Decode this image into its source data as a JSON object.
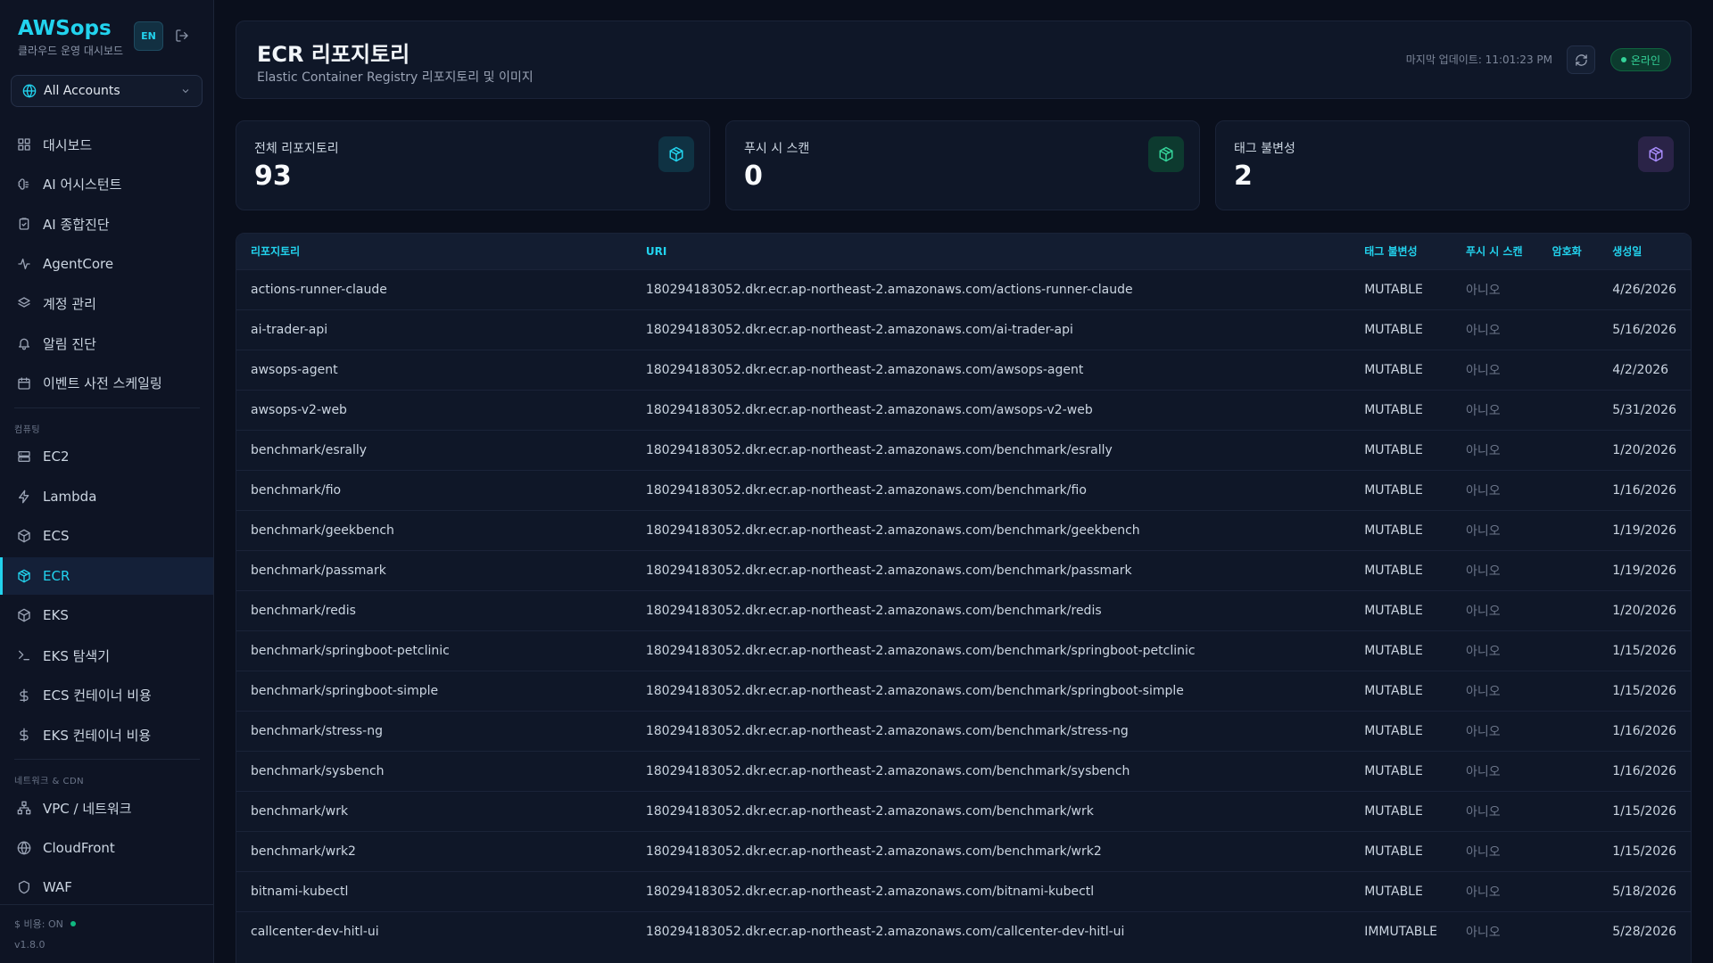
{
  "brand": {
    "name": "AWSops",
    "subtitle": "클라우드 운영 대시보드"
  },
  "lang_button": "EN",
  "account_select": {
    "value": "All Accounts"
  },
  "nav": {
    "items_top": [
      {
        "label": "대시보드",
        "icon": "dashboard-icon"
      },
      {
        "label": "AI 어시스턴트",
        "icon": "brain-icon"
      },
      {
        "label": "AI 종합진단",
        "icon": "clipboard-icon"
      },
      {
        "label": "AgentCore",
        "icon": "activity-icon"
      },
      {
        "label": "계정 관리",
        "icon": "layers-icon"
      },
      {
        "label": "알림 진단",
        "icon": "bell-icon"
      },
      {
        "label": "이벤트 사전 스케일링",
        "icon": "calendar-icon"
      }
    ],
    "section_compute": "컴퓨팅",
    "items_compute": [
      {
        "label": "EC2",
        "icon": "server-icon"
      },
      {
        "label": "Lambda",
        "icon": "lightning-icon"
      },
      {
        "label": "ECS",
        "icon": "boxes-icon"
      },
      {
        "label": "ECR",
        "icon": "package-icon",
        "active": true
      },
      {
        "label": "EKS",
        "icon": "cube-icon"
      },
      {
        "label": "EKS 탐색기",
        "icon": "terminal-icon"
      },
      {
        "label": "ECS 컨테이너 비용",
        "icon": "dollar-icon"
      },
      {
        "label": "EKS 컨테이너 비용",
        "icon": "dollar-icon"
      }
    ],
    "section_network": "네트워크 & CDN",
    "items_network": [
      {
        "label": "VPC / 네트워크",
        "icon": "network-icon"
      },
      {
        "label": "CloudFront",
        "icon": "globe-icon"
      },
      {
        "label": "WAF",
        "icon": "shield-icon"
      }
    ]
  },
  "footer": {
    "cost_label": "$ 비용: ON",
    "version": "v1.8.0"
  },
  "header": {
    "title": "ECR 리포지토리",
    "subtitle": "Elastic Container Registry 리포지토리 및 이미지",
    "last_update": "마지막 업데이트: 11:01:23 PM",
    "status": "온라인"
  },
  "stats": [
    {
      "label": "전체 리포지토리",
      "value": "93",
      "icon": "package-icon",
      "color": "#22d3ee",
      "bg": "#0f3243"
    },
    {
      "label": "푸시 시 스캔",
      "value": "0",
      "icon": "package-icon",
      "color": "#34d399",
      "bg": "#0d3a2f"
    },
    {
      "label": "태그 불변성",
      "value": "2",
      "icon": "package-icon",
      "color": "#a78bfa",
      "bg": "#2a2347"
    }
  ],
  "table": {
    "headers": [
      "리포지토리",
      "URI",
      "태그 불변성",
      "푸시 시 스캔",
      "암호화",
      "생성일"
    ],
    "rows": [
      [
        "actions-runner-claude",
        "180294183052.dkr.ecr.ap-northeast-2.amazonaws.com/actions-runner-claude",
        "MUTABLE",
        "아니오",
        "",
        "4/26/2026"
      ],
      [
        "ai-trader-api",
        "180294183052.dkr.ecr.ap-northeast-2.amazonaws.com/ai-trader-api",
        "MUTABLE",
        "아니오",
        "",
        "5/16/2026"
      ],
      [
        "awsops-agent",
        "180294183052.dkr.ecr.ap-northeast-2.amazonaws.com/awsops-agent",
        "MUTABLE",
        "아니오",
        "",
        "4/2/2026"
      ],
      [
        "awsops-v2-web",
        "180294183052.dkr.ecr.ap-northeast-2.amazonaws.com/awsops-v2-web",
        "MUTABLE",
        "아니오",
        "",
        "5/31/2026"
      ],
      [
        "benchmark/esrally",
        "180294183052.dkr.ecr.ap-northeast-2.amazonaws.com/benchmark/esrally",
        "MUTABLE",
        "아니오",
        "",
        "1/20/2026"
      ],
      [
        "benchmark/fio",
        "180294183052.dkr.ecr.ap-northeast-2.amazonaws.com/benchmark/fio",
        "MUTABLE",
        "아니오",
        "",
        "1/16/2026"
      ],
      [
        "benchmark/geekbench",
        "180294183052.dkr.ecr.ap-northeast-2.amazonaws.com/benchmark/geekbench",
        "MUTABLE",
        "아니오",
        "",
        "1/19/2026"
      ],
      [
        "benchmark/passmark",
        "180294183052.dkr.ecr.ap-northeast-2.amazonaws.com/benchmark/passmark",
        "MUTABLE",
        "아니오",
        "",
        "1/19/2026"
      ],
      [
        "benchmark/redis",
        "180294183052.dkr.ecr.ap-northeast-2.amazonaws.com/benchmark/redis",
        "MUTABLE",
        "아니오",
        "",
        "1/20/2026"
      ],
      [
        "benchmark/springboot-petclinic",
        "180294183052.dkr.ecr.ap-northeast-2.amazonaws.com/benchmark/springboot-petclinic",
        "MUTABLE",
        "아니오",
        "",
        "1/15/2026"
      ],
      [
        "benchmark/springboot-simple",
        "180294183052.dkr.ecr.ap-northeast-2.amazonaws.com/benchmark/springboot-simple",
        "MUTABLE",
        "아니오",
        "",
        "1/15/2026"
      ],
      [
        "benchmark/stress-ng",
        "180294183052.dkr.ecr.ap-northeast-2.amazonaws.com/benchmark/stress-ng",
        "MUTABLE",
        "아니오",
        "",
        "1/16/2026"
      ],
      [
        "benchmark/sysbench",
        "180294183052.dkr.ecr.ap-northeast-2.amazonaws.com/benchmark/sysbench",
        "MUTABLE",
        "아니오",
        "",
        "1/16/2026"
      ],
      [
        "benchmark/wrk",
        "180294183052.dkr.ecr.ap-northeast-2.amazonaws.com/benchmark/wrk",
        "MUTABLE",
        "아니오",
        "",
        "1/15/2026"
      ],
      [
        "benchmark/wrk2",
        "180294183052.dkr.ecr.ap-northeast-2.amazonaws.com/benchmark/wrk2",
        "MUTABLE",
        "아니오",
        "",
        "1/15/2026"
      ],
      [
        "bitnami-kubectl",
        "180294183052.dkr.ecr.ap-northeast-2.amazonaws.com/bitnami-kubectl",
        "MUTABLE",
        "아니오",
        "",
        "5/18/2026"
      ],
      [
        "callcenter-dev-hitl-ui",
        "180294183052.dkr.ecr.ap-northeast-2.amazonaws.com/callcenter-dev-hitl-ui",
        "IMMUTABLE",
        "아니오",
        "",
        "5/28/2026"
      ]
    ]
  }
}
